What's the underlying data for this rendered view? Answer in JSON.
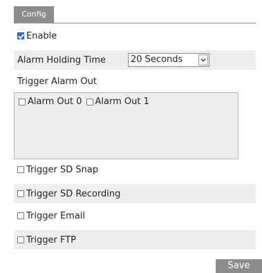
{
  "tabs": [
    {
      "label": "Config",
      "active": true
    }
  ],
  "enable": {
    "label": "Enable",
    "checked": true
  },
  "alarm_holding_time": {
    "label": "Alarm Holding Time",
    "selected": "20 Seconds"
  },
  "trigger_alarm_out": {
    "label": "Trigger Alarm Out",
    "options": [
      {
        "label": "Alarm Out 0",
        "checked": false
      },
      {
        "label": "Alarm Out 1",
        "checked": false
      }
    ]
  },
  "triggers": [
    {
      "label": "Trigger SD Snap",
      "checked": false
    },
    {
      "label": "Trigger SD Recording",
      "checked": false
    },
    {
      "label": "Trigger Email",
      "checked": false
    },
    {
      "label": "Trigger FTP",
      "checked": false
    }
  ],
  "save_label": "Save",
  "colors": {
    "tab_bg": "#8d8d8d",
    "row_shade": "#eeeeee",
    "checkbox_checked": "#1f6fd6"
  }
}
